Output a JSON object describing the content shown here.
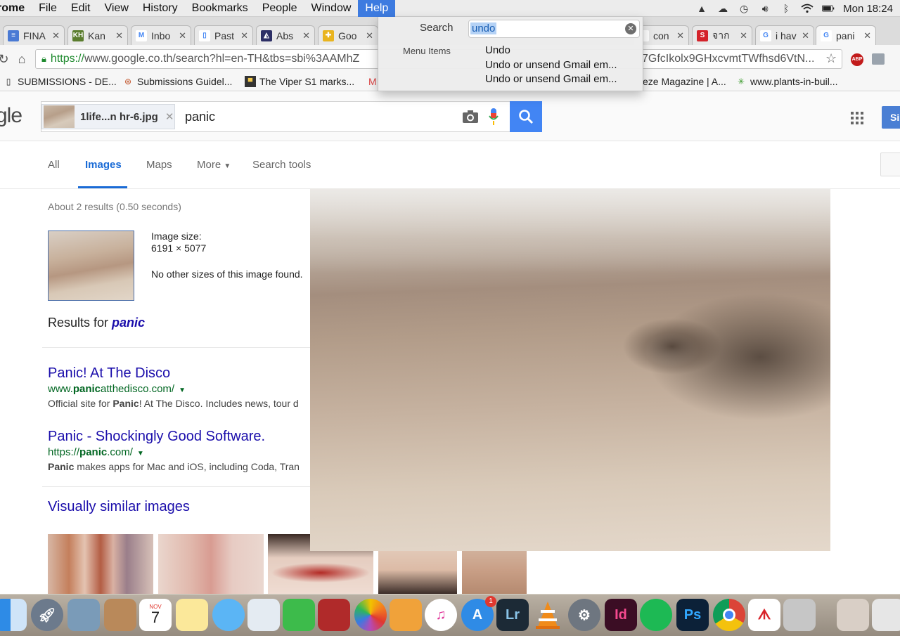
{
  "menubar": {
    "app": "rome",
    "items": [
      "File",
      "Edit",
      "View",
      "History",
      "Bookmarks",
      "People",
      "Window",
      "Help"
    ],
    "clock": "Mon 18:24"
  },
  "tabs": [
    {
      "label": "FINA",
      "fav": "≡",
      "color": "#4a7ad4"
    },
    {
      "label": "Kan",
      "fav": "KH",
      "color": "#5b7d2e"
    },
    {
      "label": "Inbo",
      "fav": "M",
      "color": "#ffffff"
    },
    {
      "label": "Past",
      "fav": "▯",
      "color": "#ffffff"
    },
    {
      "label": "Abs",
      "fav": "◭",
      "color": "#2d2f66"
    },
    {
      "label": "Goo",
      "fav": "✚",
      "color": "#e9b41f"
    },
    {
      "label": "con",
      "fav": "",
      "color": "#ffffff"
    },
    {
      "label": "จาก",
      "fav": "S",
      "color": "#d4232b"
    },
    {
      "label": "i hav",
      "fav": "G",
      "color": "#ffffff"
    },
    {
      "label": "pani",
      "fav": "G",
      "color": "#ffffff"
    }
  ],
  "omnibox": {
    "scheme": "https://",
    "host_path": "www.google.co.th/search?hl=en-TH&tbs=sbi%3AAMhZ",
    "url_tail": "7GfcIkolx9GHxcvmtTWfhsd6VtN..."
  },
  "bookmarks": [
    "SUBMISSIONS - DE...",
    "Submissions Guidel...",
    "The Viper S1 marks...",
    "M",
    "eze Magazine | A...",
    "www.plants-in-buil..."
  ],
  "help_menu": {
    "search_label": "Search",
    "search_value": "undo",
    "section_label": "Menu Items",
    "items": [
      "Undo",
      "Undo or unsend Gmail em...",
      "Undo or unsend Gmail em..."
    ]
  },
  "search": {
    "logo_fragment": "gle",
    "image_chip": "1life...n hr-6.jpg",
    "query": "panic"
  },
  "nav": {
    "items": [
      "All",
      "Images",
      "Maps",
      "More",
      "Search tools"
    ],
    "active": "Images"
  },
  "results": {
    "stats": "About 2 results (0.50 seconds)",
    "image_size_label": "Image size:",
    "image_size_value": "6191 × 5077",
    "no_other_sizes": "No other sizes of this image found.",
    "results_for_prefix": "Results for ",
    "results_for_query": "panic",
    "items": [
      {
        "title": "Panic! At The Disco",
        "url_prefix": "www.",
        "url_bold": "panic",
        "url_suffix": "atthedisco.com/",
        "snippet_prefix": "Official site for ",
        "snippet_bold": "Panic",
        "snippet_suffix": "! At The Disco. Includes news, tour d"
      },
      {
        "title": "Panic - Shockingly Good Software.",
        "url_prefix": "https://",
        "url_bold": "panic",
        "url_suffix": ".com/",
        "snippet_prefix": "",
        "snippet_bold": "Panic",
        "snippet_suffix": " makes apps for Mac and iOS, including Coda, Tran"
      }
    ],
    "similar_title": "Visually similar images"
  },
  "dock": {
    "calendar_month": "NOV",
    "calendar_day": "7",
    "appstore_badge": "1",
    "apps": [
      "Finder",
      "Launchpad",
      "Preview",
      "Contacts",
      "Calendar",
      "Notes",
      "Messages",
      "Photo Booth",
      "FaceTime",
      "Photo Booth",
      "Photos",
      "Pages",
      "iTunes",
      "App Store",
      "Lightroom",
      "VLC",
      "System Preferences",
      "InDesign",
      "Spotify",
      "Photoshop",
      "Chrome",
      "Acrobat",
      "Utility",
      "User",
      "Trash"
    ],
    "labels": {
      "lr": "Lr",
      "id": "Id",
      "ps": "Ps"
    }
  },
  "colors": {
    "accent": "#4285f4",
    "link": "#1a0dab",
    "url": "#006621"
  }
}
